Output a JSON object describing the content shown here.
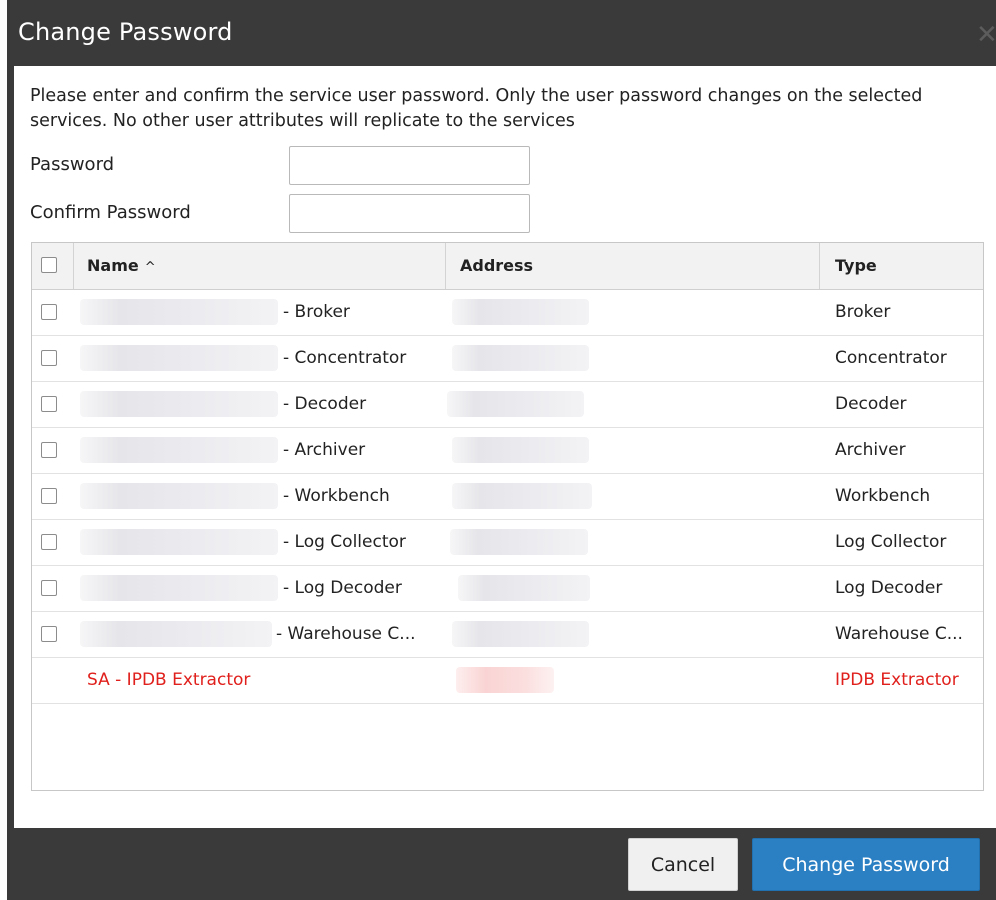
{
  "dialog": {
    "title": "Change Password",
    "close_icon": "close-icon",
    "instructions": "Please enter and confirm the service user password. Only the user password changes on the selected services. No other user attributes will replicate to the services",
    "password_label": "Password",
    "password_value": "",
    "confirm_label": "Confirm Password",
    "confirm_value": ""
  },
  "grid": {
    "columns": {
      "name": "Name",
      "address": "Address",
      "type": "Type"
    },
    "sort_indicator": "^",
    "rows": [
      {
        "name": "- Broker",
        "type": "Broker",
        "checkbox": true
      },
      {
        "name": "- Concentrator",
        "type": "Concentrator",
        "checkbox": true
      },
      {
        "name": "- Decoder",
        "type": "Decoder",
        "checkbox": true
      },
      {
        "name": "- Archiver",
        "type": "Archiver",
        "checkbox": true
      },
      {
        "name": "- Workbench",
        "type": "Workbench",
        "checkbox": true
      },
      {
        "name": "- Log Collector",
        "type": "Log Collector",
        "checkbox": true
      },
      {
        "name": "- Log Decoder",
        "type": "Log Decoder",
        "checkbox": true
      },
      {
        "name": "- Warehouse C...",
        "type": "Warehouse C...",
        "checkbox": true
      },
      {
        "name": "SA - IPDB Extractor",
        "type": "IPDB Extractor",
        "checkbox": false,
        "error": true
      }
    ]
  },
  "footer": {
    "cancel_label": "Cancel",
    "submit_label": "Change Password"
  },
  "colors": {
    "titlebar": "#3a3a3a",
    "primary_button": "#2b7fc3",
    "error_text": "#e0201c"
  }
}
